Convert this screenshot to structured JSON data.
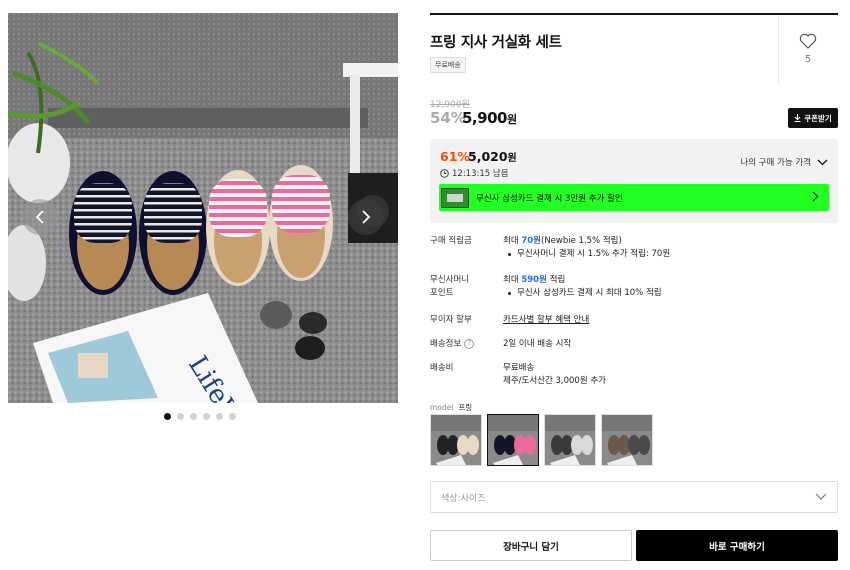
{
  "product": {
    "title": "프링 지사 거실화 세트",
    "badge": "무료배송",
    "like_count": "5"
  },
  "price": {
    "original": "12,900원",
    "discount": "54%",
    "sale_value": "5,900",
    "sale_unit": "원",
    "coupon_label": "쿠폰받기"
  },
  "best_price": {
    "percent": "61%",
    "value": "5,020",
    "unit": "원",
    "countdown": "12:13:15 남음",
    "my_price_label": "나의 구매 가능 가격",
    "promo_text": "무신사 삼성카드 결제 시 3만원 추가 할인",
    "promo_color": "#22ff22"
  },
  "details": {
    "points": {
      "label": "구매 적립금",
      "prefix": "최대 ",
      "amount": "70원",
      "suffix": "(Newbie 1.5% 적립)",
      "sub": "무신사머니 결제 시 1.5% 추가 적립: 70원"
    },
    "money": {
      "label1": "무신사머니",
      "label2": "포인트",
      "prefix": "최대 ",
      "amount": "590원",
      "suffix": " 적립",
      "sub": "무신사 삼성카드 결제 시 최대 10% 적립"
    },
    "installment": {
      "label": "무이자 할부",
      "value": "카드사별 할부 혜택 안내"
    },
    "shipping_info": {
      "label": "배송정보",
      "value": "2일 이내 배송 시작"
    },
    "shipping_fee": {
      "label": "배송비",
      "value1": "무료배송",
      "value2": "제주/도서산간 3,000원 추가"
    }
  },
  "model": {
    "label": "model",
    "value": "프링"
  },
  "options": {
    "placeholder": "색상:사이즈"
  },
  "actions": {
    "cart": "장바구니 담기",
    "buy": "바로 구매하기"
  },
  "gallery": {
    "slide_count": 6,
    "active_index": 0,
    "magazine_text": "LifeWear"
  },
  "colors": {
    "accent_orange": "#ff4800",
    "link_blue": "#1f6dff"
  }
}
